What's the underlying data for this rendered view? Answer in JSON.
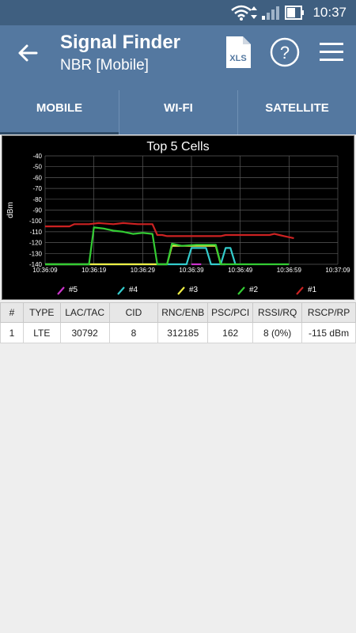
{
  "status_bar": {
    "time": "10:37"
  },
  "app_bar": {
    "title": "Signal Finder",
    "subtitle": "NBR [Mobile]",
    "xls_label": "XLS",
    "help_label": "?"
  },
  "tabs": [
    {
      "label": "MOBILE",
      "selected": true
    },
    {
      "label": "WI-FI",
      "selected": false
    },
    {
      "label": "SATELLITE",
      "selected": false
    }
  ],
  "chart_data": {
    "type": "line",
    "title": "Top 5 Cells",
    "ylabel": "dBm",
    "xlabel": "",
    "ylim": [
      -140,
      -40
    ],
    "yticks": [
      "-40",
      "-50",
      "-60",
      "-70",
      "-80",
      "-90",
      "-100",
      "-110",
      "-120",
      "-130",
      "-140"
    ],
    "xticks": [
      "10:36:09",
      "10:36:19",
      "10:36:29",
      "10:36:39",
      "10:36:49",
      "10:36:59",
      "10:37:09"
    ],
    "xrange": [
      "10:36:09",
      "10:37:09"
    ],
    "legend_position": "bottom",
    "grid": true,
    "series": [
      {
        "name": "#5",
        "color": "#cc33cc",
        "points": [
          [
            "10:36:39",
            -140
          ],
          [
            "10:36:41",
            -140
          ]
        ]
      },
      {
        "name": "#4",
        "color": "#33cccc",
        "points": [
          [
            "10:36:09",
            -140
          ],
          [
            "10:36:38",
            -140
          ],
          [
            "10:36:39",
            -125
          ],
          [
            "10:36:42",
            -125
          ],
          [
            "10:36:43",
            -140
          ],
          [
            "10:36:45",
            -140
          ],
          [
            "10:36:46",
            -125
          ],
          [
            "10:36:47",
            -125
          ],
          [
            "10:36:48",
            -140
          ]
        ]
      },
      {
        "name": "#3",
        "color": "#eeee44",
        "points": [
          [
            "10:36:09",
            -140
          ],
          [
            "10:36:34",
            -140
          ],
          [
            "10:36:35",
            -123
          ],
          [
            "10:36:44",
            -123
          ],
          [
            "10:36:45",
            -140
          ],
          [
            "10:36:46",
            -140
          ]
        ]
      },
      {
        "name": "#2",
        "color": "#33cc33",
        "points": [
          [
            "10:36:09",
            -140
          ],
          [
            "10:36:18",
            -140
          ],
          [
            "10:36:19",
            -106
          ],
          [
            "10:36:21",
            -107
          ],
          [
            "10:36:23",
            -109
          ],
          [
            "10:36:25",
            -110
          ],
          [
            "10:36:27",
            -112
          ],
          [
            "10:36:29",
            -111
          ],
          [
            "10:36:31",
            -112
          ],
          [
            "10:36:32",
            -140
          ],
          [
            "10:36:34",
            -140
          ],
          [
            "10:36:35",
            -121
          ],
          [
            "10:36:37",
            -123
          ],
          [
            "10:36:40",
            -122
          ],
          [
            "10:36:44",
            -122
          ],
          [
            "10:36:45",
            -140
          ],
          [
            "10:36:59",
            -140
          ]
        ]
      },
      {
        "name": "#1",
        "color": "#cc2222",
        "points": [
          [
            "10:36:09",
            -105
          ],
          [
            "10:36:14",
            -105
          ],
          [
            "10:36:15",
            -103
          ],
          [
            "10:36:18",
            -103
          ],
          [
            "10:36:20",
            -102
          ],
          [
            "10:36:23",
            -103
          ],
          [
            "10:36:25",
            -102
          ],
          [
            "10:36:28",
            -103
          ],
          [
            "10:36:31",
            -103
          ],
          [
            "10:36:32",
            -113
          ],
          [
            "10:36:33",
            -113
          ],
          [
            "10:36:34",
            -114
          ],
          [
            "10:36:45",
            -114
          ],
          [
            "10:36:46",
            -113
          ],
          [
            "10:36:55",
            -113
          ],
          [
            "10:36:56",
            -112
          ],
          [
            "10:36:57",
            -113
          ],
          [
            "10:36:58",
            -114
          ],
          [
            "10:37:00",
            -116
          ]
        ]
      }
    ]
  },
  "table": {
    "headers": [
      "#",
      "TYPE",
      "LAC/TAC",
      "CID",
      "RNC/ENB",
      "PSC/PCI",
      "RSSI/RQ",
      "RSCP/RP"
    ],
    "rows": [
      [
        "1",
        "LTE",
        "30792",
        "8",
        "312185",
        "162",
        "8 (0%)",
        "-115 dBm"
      ]
    ]
  }
}
